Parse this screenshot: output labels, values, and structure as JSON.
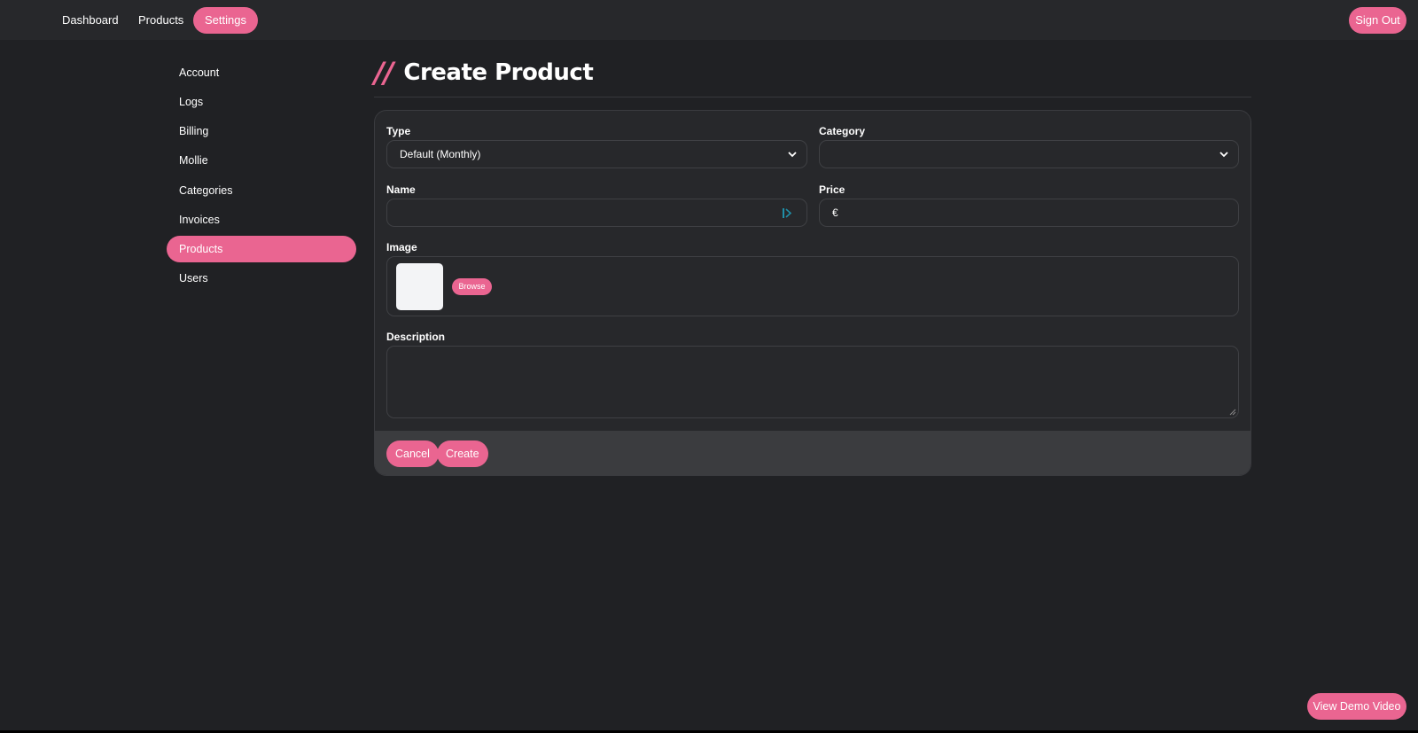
{
  "topnav": {
    "items": [
      {
        "label": "Dashboard"
      },
      {
        "label": "Products"
      },
      {
        "label": "Settings"
      }
    ],
    "active": "Settings",
    "signout_label": "Sign Out"
  },
  "sidebar": {
    "items": [
      {
        "label": "Account"
      },
      {
        "label": "Logs"
      },
      {
        "label": "Billing"
      },
      {
        "label": "Mollie"
      },
      {
        "label": "Categories"
      },
      {
        "label": "Invoices"
      },
      {
        "label": "Products"
      },
      {
        "label": "Users"
      }
    ],
    "active": "Products"
  },
  "page": {
    "title_prefix": "//",
    "title": "Create Product"
  },
  "form": {
    "type": {
      "label": "Type",
      "value": "Default (Monthly)"
    },
    "category": {
      "label": "Category",
      "value": ""
    },
    "name": {
      "label": "Name",
      "value": ""
    },
    "price": {
      "label": "Price",
      "currency_symbol": "€",
      "value": ""
    },
    "image": {
      "label": "Image",
      "browse_label": "Browse"
    },
    "description": {
      "label": "Description",
      "value": ""
    }
  },
  "footer": {
    "cancel_label": "Cancel",
    "create_label": "Create"
  },
  "demo_button_label": "View Demo Video",
  "colors": {
    "accent": "#ea6591",
    "background": "#202124",
    "panel": "#27282b"
  }
}
